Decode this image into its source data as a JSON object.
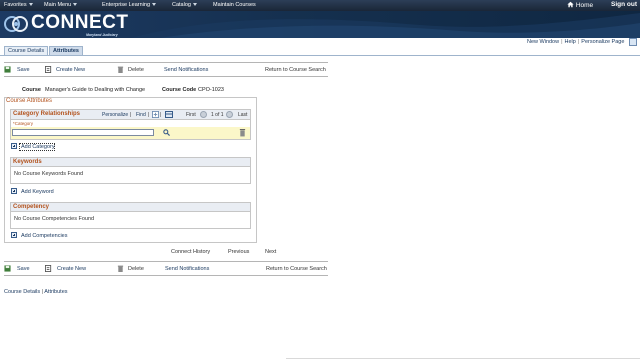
{
  "nav": {
    "items": [
      "Favorites",
      "Main Menu",
      "Enterprise Learning",
      "Catalog",
      "Maintain Courses"
    ],
    "home": "Home",
    "signout": "Sign out"
  },
  "brand": {
    "title": "CONNECT",
    "subtitle": "Maryland Judiciary"
  },
  "util_links": {
    "new_window": "New Window",
    "help": "Help",
    "personalize": "Personalize Page"
  },
  "tabs": [
    "Course Details",
    "Attributes"
  ],
  "toolbar": {
    "save": "Save",
    "create_new": "Create New",
    "delete": "Delete",
    "send_notifications": "Send Notifications",
    "return": "Return to Course Search"
  },
  "course": {
    "course_label": "Course",
    "course_name": "Manager's Guide to Dealing with Change",
    "code_label": "Course Code",
    "code_value": "CPO-1023"
  },
  "attributes": {
    "group_title": "Course Attributes",
    "category": {
      "title": "Category Relationships",
      "personalize": "Personalize",
      "find": "Find",
      "first": "First",
      "page": "1 of 1",
      "last": "Last",
      "column": "*Category",
      "value": "",
      "add": "Add Category"
    },
    "keywords": {
      "title": "Keywords",
      "empty": "No Course Keywords Found",
      "add": "Add Keyword"
    },
    "competency": {
      "title": "Competency",
      "empty": "No Course Competencies Found",
      "add": "Add Competencies"
    }
  },
  "history": {
    "connect_history": "Connect History",
    "previous": "Previous",
    "next": "Next"
  },
  "footer": {
    "course_details": "Course Details",
    "attributes": "Attributes"
  },
  "colors": {
    "nav_bg": "#1a2637",
    "banner_bg": "#15304f",
    "link": "#17365d",
    "section_title": "#b3531e",
    "highlight_row": "#fbf7c9"
  }
}
